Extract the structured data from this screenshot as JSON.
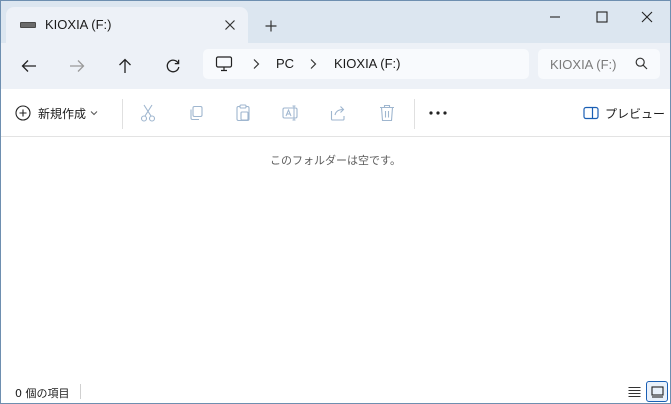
{
  "window": {
    "tab_title": "KIOXIA (F:)",
    "minimize_icon": "minimize-icon",
    "maximize_icon": "maximize-icon",
    "close_icon": "close-icon"
  },
  "nav": {
    "breadcrumb": [
      "PC",
      "KIOXIA (F:)"
    ],
    "search_placeholder": "KIOXIA (F:)"
  },
  "commands": {
    "new_label": "新規作成",
    "preview_label": "プレビュー",
    "icons": [
      "cut-icon",
      "copy-icon",
      "paste-icon",
      "rename-icon",
      "share-icon",
      "delete-icon"
    ]
  },
  "content": {
    "empty_message": "このフォルダーは空です。"
  },
  "status": {
    "item_count": "0 個の項目"
  },
  "colors": {
    "titlebar": "#dce6f0",
    "navbar": "#edf1f7",
    "accent": "#1a5fb4",
    "disabled_icon": "#9fb6cf"
  }
}
